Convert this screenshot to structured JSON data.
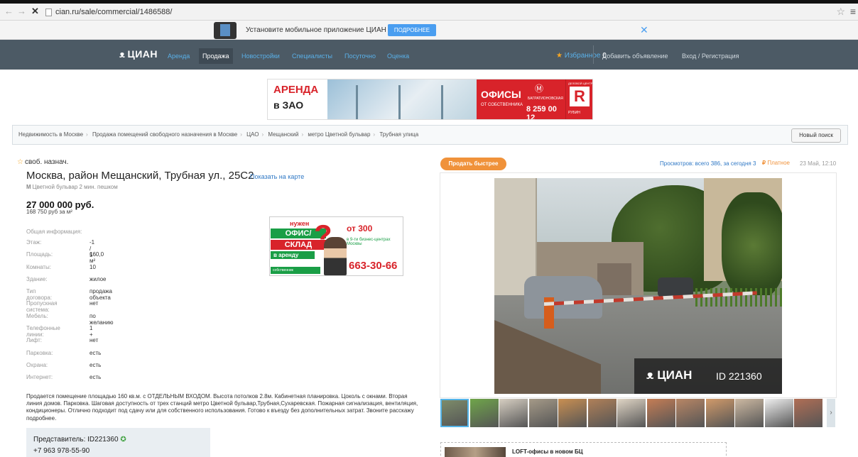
{
  "browser": {
    "url": "cian.ru/sale/commercial/1486588/"
  },
  "promo": {
    "text": "Установите мобильное приложение ЦИАН",
    "button": "ПОДРОБНЕЕ"
  },
  "nav": {
    "logo": "ЦИАН",
    "links": [
      "Аренда",
      "Продажа",
      "Новостройки",
      "Специалисты",
      "Посуточно",
      "Оценка"
    ],
    "favorites": "Избранное",
    "favorites_count": "0",
    "add_listing": "Добавить объявление",
    "login": "Вход / Регистрация"
  },
  "banner": {
    "line1": "АРЕНДА",
    "line2": "в ЗАО",
    "offices": "ОФИСЫ",
    "owner": "ОТ СОБСТВЕННИКА",
    "metro": "БАГРАТИОНОВСКАЯ",
    "phone": "8 259 00 12",
    "brand": "РУБИН",
    "brand_top": "ДЕЛОВОЙ ЦЕНТР"
  },
  "breadcrumbs": [
    "Недвижимость в Москве",
    "Продажа помещений свободного назначения в Москве",
    "ЦАО",
    "Мещанский",
    "метро Цветной бульвар",
    "Трубная улица"
  ],
  "new_search": "Новый поиск",
  "listing": {
    "category": "своб. назнач.",
    "address": "Москва, район Мещанский, Трубная ул., 25С2",
    "show_map": "Показать на карте",
    "metro": "Цветной бульвар 2 мин. пешком",
    "price": "27 000 000 руб.",
    "price_per_m2": "168 750 руб за м²",
    "general_info": "Общая информация:",
    "properties": [
      {
        "label": "Этаж:",
        "value": "-1 / 5"
      },
      {
        "label": "Площадь:",
        "value": "160,0 м²"
      },
      {
        "label": "Комнаты:",
        "value": "10"
      },
      {
        "label": "Здание:",
        "value": "жилое"
      },
      {
        "label": "Тип договора:",
        "value": "продажа объекта"
      },
      {
        "label": "Пропускная система:",
        "value": "нет"
      },
      {
        "label": "Мебель:",
        "value": "по желанию"
      },
      {
        "label": "Телефонные линии:",
        "value": "1 +"
      },
      {
        "label": "Лифт:",
        "value": "нет"
      },
      {
        "label": "Парковка:",
        "value": "есть"
      },
      {
        "label": "Охрана:",
        "value": "есть"
      },
      {
        "label": "Интернет:",
        "value": "есть"
      }
    ],
    "description": "Продается помещение площадью 160 кв.м. с ОТДЕЛЬНЫМ ВХОДОМ. Высота потолков 2.8м. Кабинетная планировка. Цоколь с окнами. Вторая линия домов. Парковка. Шаговая доступность от трех станций метро Цветной бульвар,Трубная,Сухаревская. Пожарная сигнализация, вентиляция, кондиционеры. Отлично подходит под сдачу или для собственного использования. Готово к въезду без дополнительных затрат. Звоните расскажу подробнее.",
    "representative": "Представитель: ID221360",
    "phone": "+7 963 978-55-90"
  },
  "ad": {
    "need": "нужен",
    "office": "ОФИС/",
    "sklad": "СКЛАД",
    "arenda": "в аренду",
    "from": "от 300",
    "bc": "в 9-ти бизнес-центрах Москвы",
    "phone": "663-30-66",
    "foot": "собственник"
  },
  "right": {
    "sell_fast": "Продать быстрее",
    "views": "Просмотров: всего 386, за сегодня 3",
    "paid": "Платное",
    "date": "23 Май, 12:10",
    "watermark_logo": "ЦИАН",
    "watermark_id": "ID 221360",
    "related_title": "LOFT-офисы в новом БЦ"
  },
  "colors": {
    "nav_bg": "#4c5a65",
    "link": "#2f78c5",
    "accent_orange": "#f0923a",
    "banner_red": "#d8232a"
  },
  "thumbnail_colors": [
    "#7d8c6a",
    "#6fa54a",
    "#d7cfc2",
    "#a59a88",
    "#c98f52",
    "#b08058",
    "#e0d5c5",
    "#c57d55",
    "#b88665",
    "#d19a6a",
    "#cdb9a2",
    "#efefef",
    "#b06e55"
  ],
  "icons": [
    "back-icon",
    "forward-icon",
    "close-tab-icon",
    "page-icon",
    "bookmark-star-icon",
    "menu-icon",
    "close-icon",
    "cian-logo-icon",
    "favorite-star-icon",
    "metro-icon",
    "paid-icon",
    "verified-icon"
  ]
}
